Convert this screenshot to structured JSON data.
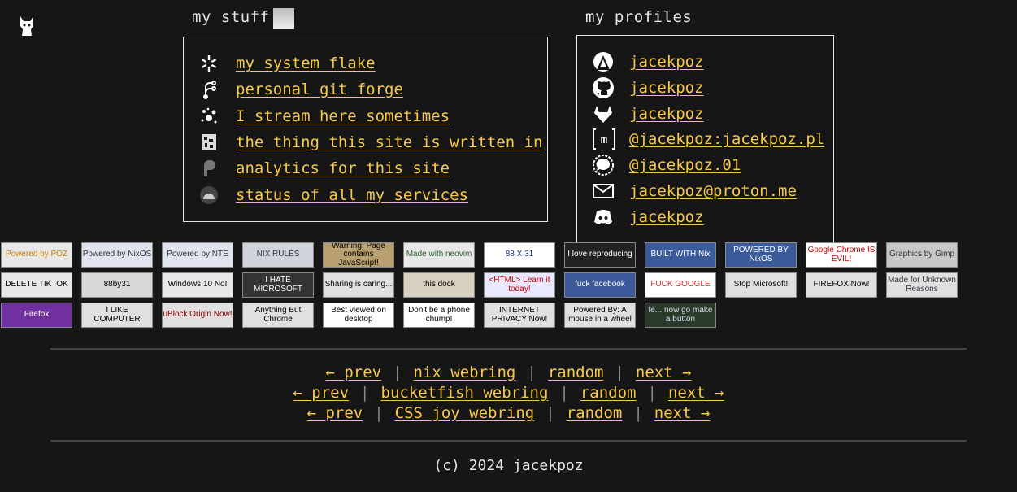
{
  "stuff": {
    "title": "my stuff",
    "items": [
      {
        "label": "my system flake",
        "icon": "nixos-snowflake-icon"
      },
      {
        "label": "personal git forge",
        "icon": "forgejo-icon"
      },
      {
        "label": "I stream here sometimes",
        "icon": "owncast-icon"
      },
      {
        "label": "the thing this site is written in",
        "icon": "static-site-generator-icon"
      },
      {
        "label": "analytics for this site",
        "icon": "plausible-icon"
      },
      {
        "label": "status of all my services",
        "icon": "uptime-kuma-icon"
      }
    ]
  },
  "profiles": {
    "title": "my profiles",
    "items": [
      {
        "label": "jacekpoz",
        "icon": "codeberg-icon"
      },
      {
        "label": "jacekpoz",
        "icon": "github-icon"
      },
      {
        "label": "jacekpoz",
        "icon": "gitlab-icon"
      },
      {
        "label": "@jacekpoz:jacekpoz.pl",
        "icon": "matrix-icon"
      },
      {
        "label": "@jacekpoz.01",
        "icon": "signal-icon"
      },
      {
        "label": "jacekpoz@proton.me",
        "icon": "mail-icon"
      },
      {
        "label": "jacekpoz",
        "icon": "discord-icon"
      }
    ]
  },
  "badges": [
    {
      "text": "Powered by POZ",
      "bg": "#e8e8e8",
      "fg": "#d08000"
    },
    {
      "text": "Powered by NixOS",
      "bg": "#dfe4ee",
      "fg": "#333"
    },
    {
      "text": "Powered by NTE",
      "bg": "#dfe4ee",
      "fg": "#333"
    },
    {
      "text": "NIX RULES",
      "bg": "#cfd4dc",
      "fg": "#333"
    },
    {
      "text": "Warning: Page contains JavaScript!",
      "bg": "#b8a070",
      "fg": "#000"
    },
    {
      "text": "Made with neovim",
      "bg": "#e8e8e8",
      "fg": "#2a6a2a"
    },
    {
      "text": "88 X 31",
      "bg": "#ffffff",
      "fg": "#1a2a80"
    },
    {
      "text": "I love reproducing",
      "bg": "#222",
      "fg": "#fff"
    },
    {
      "text": "BUILT WITH Nix",
      "bg": "#3a5a9a",
      "fg": "#fff"
    },
    {
      "text": "POWERED BY NixOS",
      "bg": "#3a5a9a",
      "fg": "#fff"
    },
    {
      "text": "Google Chrome IS EVIL!",
      "bg": "#fff",
      "fg": "#c00"
    },
    {
      "text": "Graphics by Gimp",
      "bg": "#c8c8c8",
      "fg": "#333"
    },
    {
      "text": "DELETE TIKTOK",
      "bg": "#e8e8e8",
      "fg": "#000"
    },
    {
      "text": "88by31",
      "bg": "#d8d8d8",
      "fg": "#000"
    },
    {
      "text": "Windows 10 No!",
      "bg": "#e8e8e8",
      "fg": "#000"
    },
    {
      "text": "I HATE MICROSOFT",
      "bg": "#333",
      "fg": "#fff"
    },
    {
      "text": "Sharing is caring...",
      "bg": "#e0e0e0",
      "fg": "#000"
    },
    {
      "text": "this dock",
      "bg": "#d8d0c0",
      "fg": "#000"
    },
    {
      "text": "<HTML> Learn it today!",
      "bg": "#e8e8ff",
      "fg": "#c00"
    },
    {
      "text": "fuck facebook",
      "bg": "#3b5998",
      "fg": "#fff"
    },
    {
      "text": "FUCK GOOGLE",
      "bg": "#fff",
      "fg": "#d03030"
    },
    {
      "text": "Stop Microsoft!",
      "bg": "#e0e0e0",
      "fg": "#000"
    },
    {
      "text": "FIREFOX Now!",
      "bg": "#e0e0e0",
      "fg": "#000"
    },
    {
      "text": "Made for Unknown Reasons",
      "bg": "#e0e0e0",
      "fg": "#334"
    },
    {
      "text": "Firefox",
      "bg": "#7030a0",
      "fg": "#fff"
    },
    {
      "text": "I LIKE COMPUTER",
      "bg": "#e0e0e0",
      "fg": "#000"
    },
    {
      "text": "uBlock Origin Now!",
      "bg": "#e0e0e0",
      "fg": "#800"
    },
    {
      "text": "Anything But Chrome",
      "bg": "#e0e0e0",
      "fg": "#000"
    },
    {
      "text": "Best viewed on desktop",
      "bg": "#fff",
      "fg": "#000"
    },
    {
      "text": "Don't be a phone chump!",
      "bg": "#fff",
      "fg": "#000"
    },
    {
      "text": "INTERNET PRIVACY Now!",
      "bg": "#e0e0e0",
      "fg": "#000"
    },
    {
      "text": "Powered By: A mouse in a wheel",
      "bg": "#e0e0e0",
      "fg": "#000"
    },
    {
      "text": "fe... now go make a button",
      "bg": "#2a3a2a",
      "fg": "#dde"
    }
  ],
  "webrings": [
    {
      "prev": "← prev",
      "name": "nix webring",
      "random": "random",
      "next": "next →"
    },
    {
      "prev": "← prev",
      "name": "bucketfish webring",
      "random": "random",
      "next": "next →"
    },
    {
      "prev": "← prev",
      "name": "CSS joy webring",
      "random": "random",
      "next": "next →"
    }
  ],
  "separator": "|",
  "footer": "(c) 2024 jacekpoz"
}
